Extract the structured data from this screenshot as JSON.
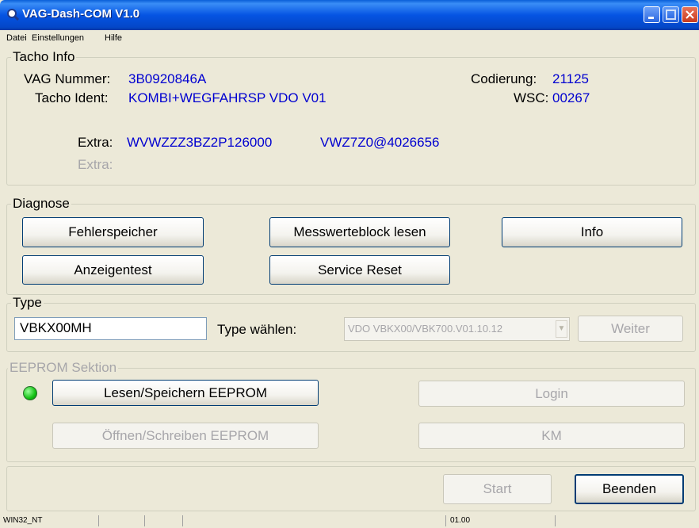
{
  "window": {
    "title": "VAG-Dash-COM V1.0"
  },
  "menu": {
    "items": [
      "Datei",
      "Einstellungen",
      "Hilfe"
    ]
  },
  "tacho": {
    "group_title": "Tacho Info",
    "vag_nummer_label": "VAG Nummer:",
    "vag_nummer": "3B0920846A",
    "tacho_ident_label": "Tacho Ident:",
    "tacho_ident": "KOMBI+WEGFAHRSP VDO V01",
    "codierung_label": "Codierung:",
    "codierung": "21125",
    "wsc_label": "WSC:",
    "wsc": "00267",
    "extra_label": "Extra:",
    "extra_value_1": "WVWZZZ3BZ2P126000",
    "extra_value_2": "VWZ7Z0@4026656",
    "extra2_label": "Extra:"
  },
  "diagnose": {
    "group_title": "Diagnose",
    "fehlerspeicher": "Fehlerspeicher",
    "messwerteblock": "Messwerteblock lesen",
    "info": "Info",
    "anzeigentest": "Anzeigentest",
    "service_reset": "Service Reset"
  },
  "type": {
    "group_title": "Type",
    "input_value": "VBKX00MH",
    "select_label": "Type wählen:",
    "select_value": "VDO  VBKX00/VBK700.V01.10.12",
    "weiter": "Weiter"
  },
  "eeprom": {
    "group_title": "EEPROM Sektion",
    "lesen": "Lesen/Speichern EEPROM",
    "oeffnen": "Öffnen/Schreiben EEPROM",
    "login": "Login",
    "km": "KM",
    "status_color": "#13c113"
  },
  "footer": {
    "start": "Start",
    "beenden": "Beenden"
  },
  "statusbar": {
    "os": "WIN32_NT",
    "version": "01.00"
  }
}
